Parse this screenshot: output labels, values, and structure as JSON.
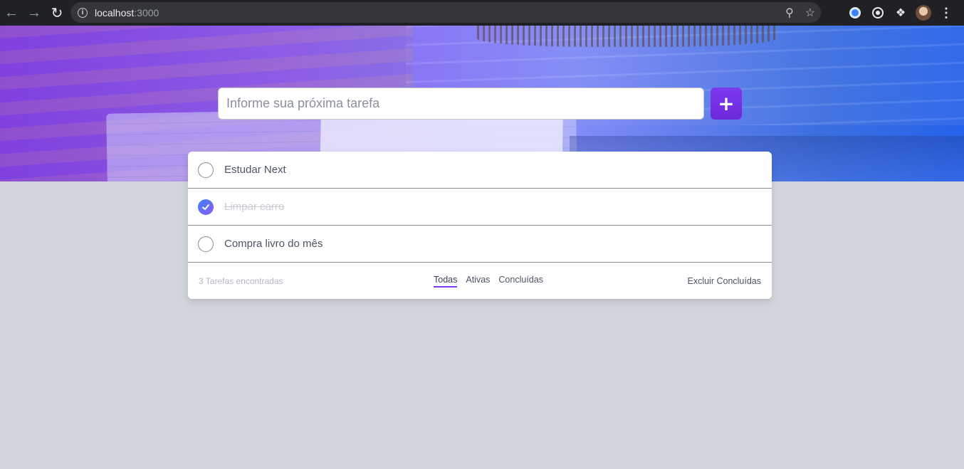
{
  "browser": {
    "url_host": "localhost",
    "url_port": ":3000",
    "back_icon": "arrow-left-icon",
    "forward_icon": "arrow-right-icon",
    "reload_icon": "reload-icon"
  },
  "new_task": {
    "placeholder": "Informe sua próxima tarefa",
    "value": "",
    "add_label": "+"
  },
  "tasks": [
    {
      "label": "Estudar Next",
      "completed": false
    },
    {
      "label": "Limpar carro",
      "completed": true
    },
    {
      "label": "Compra livro do mês",
      "completed": false
    }
  ],
  "footer": {
    "count_text": "3 Tarefas encontradas",
    "filters": [
      {
        "label": "Todas",
        "active": true
      },
      {
        "label": "Ativas",
        "active": false
      },
      {
        "label": "Concluídas",
        "active": false
      }
    ],
    "clear_label": "Excluir Concluídas"
  },
  "colors": {
    "accent": "#7c3aed",
    "banner_start": "#7c3aed",
    "banner_end": "#2563eb",
    "page_bg": "#d1d5dc"
  }
}
